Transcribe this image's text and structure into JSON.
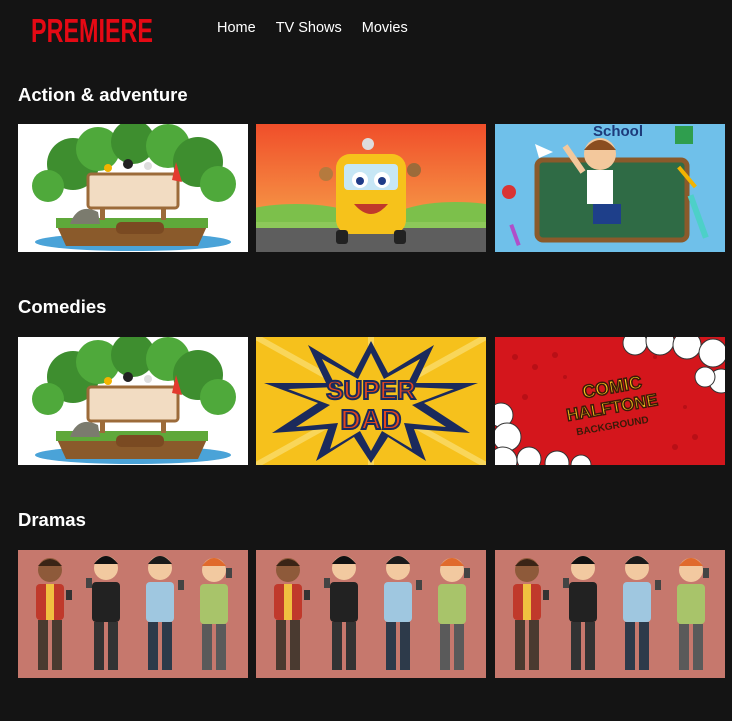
{
  "brand": {
    "name": "PREMIERE",
    "color": "#e50914"
  },
  "nav": {
    "items": [
      {
        "label": "Home"
      },
      {
        "label": "TV Shows"
      },
      {
        "label": "Movies"
      }
    ]
  },
  "sections": [
    {
      "title": "Action & adventure",
      "tiles": [
        {
          "art": "island-with-birds-and-signboard"
        },
        {
          "art": "school-bus-with-animals"
        },
        {
          "art": "back-to-school-boy-chalkboard",
          "text": "School"
        }
      ]
    },
    {
      "title": "Comedies",
      "tiles": [
        {
          "art": "island-with-birds-and-signboard"
        },
        {
          "art": "super-dad-comic-burst",
          "text": [
            "SUPER",
            "DAD"
          ]
        },
        {
          "art": "comic-halftone-background",
          "text": [
            "COMIC",
            "HALFTONE",
            "BACKGROUND"
          ]
        }
      ]
    },
    {
      "title": "Dramas",
      "tiles": [
        {
          "art": "four-boys-with-phones"
        },
        {
          "art": "four-boys-with-phones"
        },
        {
          "art": "four-boys-with-phones"
        }
      ]
    }
  ]
}
